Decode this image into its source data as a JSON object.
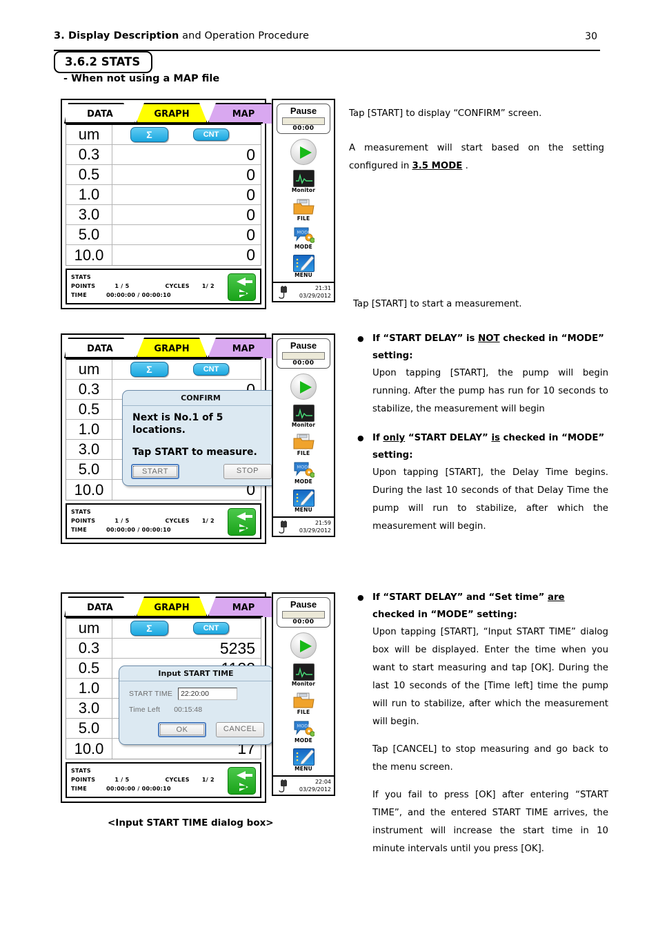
{
  "header": {
    "title_bold": "3. Display Description",
    "title_rest": " and Operation Procedure",
    "page_number": "30"
  },
  "section": {
    "number_title": "3.6.2 STATS",
    "subtitle": "- When not using a MAP file"
  },
  "device_screen": {
    "tabs": [
      {
        "label": "DATA",
        "color": "#ffffff",
        "active": true
      },
      {
        "label": "GRAPH",
        "color": "#ffff00",
        "active": false
      },
      {
        "label": "MAP",
        "color": "#d9a8f0",
        "active": false
      }
    ],
    "table_header": {
      "unit": "um",
      "sum_button": "Σ",
      "cnt_button": "CNT"
    },
    "sizes": [
      "0.3",
      "0.5",
      "1.0",
      "3.0",
      "5.0",
      "10.0"
    ],
    "values_zero": [
      "0",
      "0",
      "0",
      "0",
      "0",
      "0"
    ],
    "values_measured": [
      "5235",
      "1122",
      "",
      "",
      "",
      "17"
    ],
    "stats": {
      "title": "STATS",
      "points_label": "POINTS",
      "points_value": "1 / 5",
      "cycles_label": "CYCLES",
      "cycles_value": "1/ 2",
      "time_label": "TIME",
      "time_value": "00:00:00 / 00:00:10"
    },
    "nav_button_icon": "left-right-arrows-icon"
  },
  "side_panel": {
    "status_title": "Pause",
    "status_timer": "00:00",
    "play_button": "play-icon",
    "items": [
      {
        "icon": "monitor-icon",
        "label": "Monitor"
      },
      {
        "icon": "folder-icon",
        "label": "FILE"
      },
      {
        "icon": "mode-icon",
        "label": "MODE"
      },
      {
        "icon": "menu-icon",
        "label": "MENU"
      }
    ],
    "clock_1": {
      "time": "21:31",
      "date": "03/29/2012"
    },
    "clock_2": {
      "time": "21:59",
      "date": "03/29/2012"
    },
    "clock_3": {
      "time": "22:04",
      "date": "03/29/2012"
    },
    "power_icon": "power-plug-icon"
  },
  "confirm_dialog": {
    "title": "CONFIRM",
    "line1": "Next is No.1 of 5",
    "line2": "locations.",
    "line3": "Tap START to measure.",
    "start_button": "START",
    "stop_button": "STOP"
  },
  "start_time_dialog": {
    "title": "Input START TIME",
    "start_time_label": "START TIME",
    "start_time_value": "22:20:00",
    "time_left_label": "Time Left",
    "time_left_value": "00:15:48",
    "ok_button": "OK",
    "cancel_button": "CANCEL"
  },
  "caption": "<Input START TIME dialog box>",
  "body_text": {
    "block1_p1": "Tap [START] to display “CONFIRM” screen.",
    "block1_p2_a": "A measurement will start based on the setting configured in ",
    "block1_p2_b": "3.5 MODE",
    "block1_p2_c": " .",
    "block1_p3": "Tap [START] to start a measurement.",
    "bullet1_head_a": "If “START DELAY” is ",
    "bullet1_head_b": "NOT",
    "bullet1_head_c": " checked in “MODE” setting:",
    "bullet1_body": "Upon tapping [START], the pump will begin running. After the pump has run for 10 seconds to stabilize, the measurement will begin",
    "bullet2_head_a": "If ",
    "bullet2_head_b": "only",
    "bullet2_head_c": " “START DELAY” ",
    "bullet2_head_d": "is",
    "bullet2_head_e": " checked in “MODE” setting:",
    "bullet2_body": "Upon tapping [START], the Delay Time begins. During the last 10 seconds of that Delay Time the pump will run to stabilize, after which the measurement will begin.",
    "bullet3_head_a": "If “START DELAY” and “Set time” ",
    "bullet3_head_b": "are",
    "bullet3_head_c": " checked in “MODE” setting:",
    "bullet3_body": "Upon tapping [START], “Input START TIME” dialog box will be displayed. Enter the time when you want to start measuring and tap [OK]. During the last 10 seconds of the [Time left] time the pump will run to stabilize, after which the measurement will begin.",
    "block3_p2": "Tap [CANCEL] to stop measuring and go back to the menu screen.",
    "block3_p3": "If you fail to press [OK] after entering “START TIME”, and the entered START TIME arrives, the instrument will increase the start time in 10 minute intervals until you press [OK]."
  }
}
